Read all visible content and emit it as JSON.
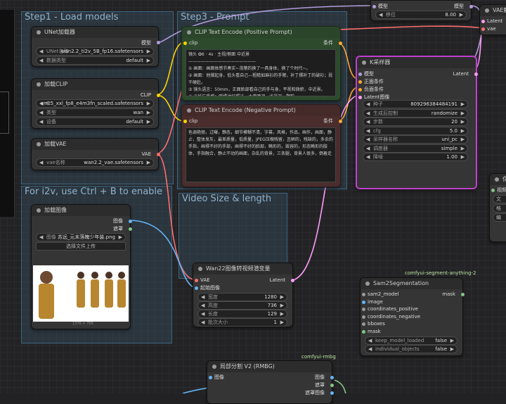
{
  "groups": {
    "step1": "Step1 - Load models",
    "step3": "Step3 - Prompt",
    "i2v": "For i2v, use Ctrl + B to enable",
    "video": "Video Size & length"
  },
  "unet": {
    "title": "UNet加载器",
    "out": "模型",
    "w1_label": "UNet名称",
    "w1_value": "wan2.2_ti2v_5B_fp16.safetensors",
    "w2_label": "数据类型",
    "w2_value": "default"
  },
  "clip": {
    "title": "加载CLIP",
    "out": "CLIP",
    "w1_label": "C",
    "w1_value": "umt5_xxl_fp8_e4m3fn_scaled.safetensors",
    "w2_label": "类型",
    "w2_value": "wan",
    "w3_label": "设备",
    "w3_value": "default"
  },
  "vae": {
    "title": "加载VAE",
    "out": "VAE",
    "w1_label": "vae名称",
    "w1_value": "wan2.2_vae.safetensors"
  },
  "pos": {
    "title": "CLIP Text Encode (Positive Prompt)",
    "in": "clip",
    "out": "条件",
    "text": "镜头 ✪6 · 4s · 主视/侧面 中近景\n————————————————\n① 画面：画面体感节奏实~茂葉的换了一具身体，换了个时代~。\n② 画面：他撑起身，低头看自己—粗糙如麻衫的手臂，补丁摞补丁的破衫；段干硬赴。\n③ 镜头语言：50mm，正面脸部看自己的手与身，平视和微俯，中近景。\n④ 光线与质感：暖橘油灯照光，土黄暗调，浅景深，颗粒。\n⑤ 风格描述：元末清朝，男主元末装「粗服子臂，破褐短褐」。"
  },
  "neg": {
    "title": "CLIP Text Encode (Negative Prompt)",
    "in": "clip",
    "out": "条件",
    "text": "色调艳丽，过曝，静态，细节模糊不清，字幕，风格，作品，画作，画面，静止，整体发灰，最差质量，低质量，JPEG压缩残留，丑陋的，残缺的，多余的手指，画得不好的手部，画得不好的脸部，畸形的，毁容的，形态畸形的肢体，手指融合，静止不动的画面，杂乱的背景，三条腿，背景人很多，倒着走"
  },
  "ksampler": {
    "title": "K采样器",
    "out": "Latent",
    "inputs": [
      "模型",
      "正面条件",
      "负面条件",
      "Latent图像"
    ],
    "widgets": [
      {
        "label": "种子",
        "value": "809296384484191"
      },
      {
        "label": "生成后控制",
        "value": "randomize"
      },
      {
        "label": "步数",
        "value": "20"
      },
      {
        "label": "cfg",
        "value": "5.0"
      },
      {
        "label": "采样器名称",
        "value": "uni_pc"
      },
      {
        "label": "调度器",
        "value": "simple"
      },
      {
        "label": "降噪",
        "value": "1.00"
      }
    ]
  },
  "model_top": {
    "in": "模型",
    "out": "模型",
    "w_label": "移位",
    "w_value": "8.00"
  },
  "vaedec": {
    "title": "VAE解",
    "in1": "Latent",
    "in2": "vae"
  },
  "loadimg": {
    "title": "加载图像",
    "out1": "图像",
    "out2": "遮罩",
    "w_label": "图像",
    "w_value": "苏远_元末落魄少年装.png",
    "upload": "选择文件上传",
    "size": "1376 × 768"
  },
  "wan22": {
    "title": "Wan22图像转视频潜变量",
    "in1": "VAE",
    "in2": "起始图像",
    "out": "Latent",
    "widgets": [
      {
        "label": "宽度",
        "value": "1280"
      },
      {
        "label": "高度",
        "value": "736"
      },
      {
        "label": "长度",
        "value": "129"
      },
      {
        "label": "批次大小",
        "value": "1"
      }
    ]
  },
  "sam": {
    "badge": "comfyui-segment-anything-2",
    "title": "Sam2Segmentation",
    "inputs": [
      "sam2_model",
      "image",
      "coordinates_positive",
      "coordinates_negative",
      "bboxes",
      "mask"
    ],
    "out": "mask",
    "widgets": [
      {
        "label": "keep_model_loaded",
        "value": "false"
      },
      {
        "label": "individual_objects",
        "value": "false"
      }
    ]
  },
  "rmbg": {
    "badge": "comfyui-rmbg",
    "title": "局部分割 V2 (RMBG)",
    "in": "图像",
    "out1": "图像",
    "out2": "遮罩",
    "out3": "遮罩图像"
  },
  "save": {
    "title": "保",
    "label": "视频",
    "item1": "文",
    "item2": "格",
    "item3": "编"
  },
  "colors": {
    "model": "#b39ddb",
    "clip": "#ffd500",
    "vae": "#ff6e6e",
    "cond": "#ffa931",
    "latent": "#ff9cf9",
    "image": "#64b5f6",
    "mask": "#81c784",
    "accent": "#c040d0"
  }
}
